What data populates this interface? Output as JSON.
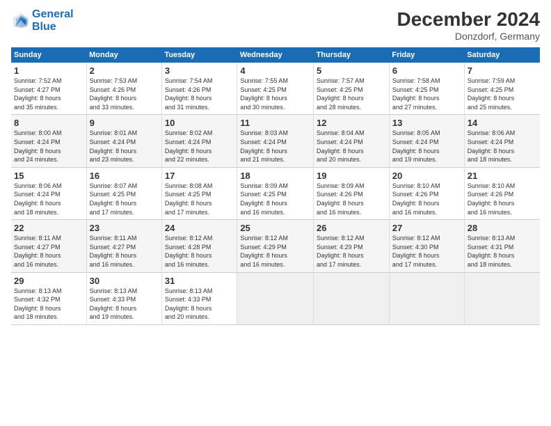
{
  "header": {
    "logo_line1": "General",
    "logo_line2": "Blue",
    "month_title": "December 2024",
    "location": "Donzdorf, Germany"
  },
  "days_of_week": [
    "Sunday",
    "Monday",
    "Tuesday",
    "Wednesday",
    "Thursday",
    "Friday",
    "Saturday"
  ],
  "weeks": [
    [
      {
        "day": "1",
        "sunrise": "7:52 AM",
        "sunset": "4:27 PM",
        "daylight": "8 hours and 35 minutes."
      },
      {
        "day": "2",
        "sunrise": "7:53 AM",
        "sunset": "4:26 PM",
        "daylight": "8 hours and 33 minutes."
      },
      {
        "day": "3",
        "sunrise": "7:54 AM",
        "sunset": "4:26 PM",
        "daylight": "8 hours and 31 minutes."
      },
      {
        "day": "4",
        "sunrise": "7:55 AM",
        "sunset": "4:25 PM",
        "daylight": "8 hours and 30 minutes."
      },
      {
        "day": "5",
        "sunrise": "7:57 AM",
        "sunset": "4:25 PM",
        "daylight": "8 hours and 28 minutes."
      },
      {
        "day": "6",
        "sunrise": "7:58 AM",
        "sunset": "4:25 PM",
        "daylight": "8 hours and 27 minutes."
      },
      {
        "day": "7",
        "sunrise": "7:59 AM",
        "sunset": "4:25 PM",
        "daylight": "8 hours and 25 minutes."
      }
    ],
    [
      {
        "day": "8",
        "sunrise": "8:00 AM",
        "sunset": "4:24 PM",
        "daylight": "8 hours and 24 minutes."
      },
      {
        "day": "9",
        "sunrise": "8:01 AM",
        "sunset": "4:24 PM",
        "daylight": "8 hours and 23 minutes."
      },
      {
        "day": "10",
        "sunrise": "8:02 AM",
        "sunset": "4:24 PM",
        "daylight": "8 hours and 22 minutes."
      },
      {
        "day": "11",
        "sunrise": "8:03 AM",
        "sunset": "4:24 PM",
        "daylight": "8 hours and 21 minutes."
      },
      {
        "day": "12",
        "sunrise": "8:04 AM",
        "sunset": "4:24 PM",
        "daylight": "8 hours and 20 minutes."
      },
      {
        "day": "13",
        "sunrise": "8:05 AM",
        "sunset": "4:24 PM",
        "daylight": "8 hours and 19 minutes."
      },
      {
        "day": "14",
        "sunrise": "8:06 AM",
        "sunset": "4:24 PM",
        "daylight": "8 hours and 18 minutes."
      }
    ],
    [
      {
        "day": "15",
        "sunrise": "8:06 AM",
        "sunset": "4:24 PM",
        "daylight": "8 hours and 18 minutes."
      },
      {
        "day": "16",
        "sunrise": "8:07 AM",
        "sunset": "4:25 PM",
        "daylight": "8 hours and 17 minutes."
      },
      {
        "day": "17",
        "sunrise": "8:08 AM",
        "sunset": "4:25 PM",
        "daylight": "8 hours and 17 minutes."
      },
      {
        "day": "18",
        "sunrise": "8:09 AM",
        "sunset": "4:25 PM",
        "daylight": "8 hours and 16 minutes."
      },
      {
        "day": "19",
        "sunrise": "8:09 AM",
        "sunset": "4:26 PM",
        "daylight": "8 hours and 16 minutes."
      },
      {
        "day": "20",
        "sunrise": "8:10 AM",
        "sunset": "4:26 PM",
        "daylight": "8 hours and 16 minutes."
      },
      {
        "day": "21",
        "sunrise": "8:10 AM",
        "sunset": "4:26 PM",
        "daylight": "8 hours and 16 minutes."
      }
    ],
    [
      {
        "day": "22",
        "sunrise": "8:11 AM",
        "sunset": "4:27 PM",
        "daylight": "8 hours and 16 minutes."
      },
      {
        "day": "23",
        "sunrise": "8:11 AM",
        "sunset": "4:27 PM",
        "daylight": "8 hours and 16 minutes."
      },
      {
        "day": "24",
        "sunrise": "8:12 AM",
        "sunset": "4:28 PM",
        "daylight": "8 hours and 16 minutes."
      },
      {
        "day": "25",
        "sunrise": "8:12 AM",
        "sunset": "4:29 PM",
        "daylight": "8 hours and 16 minutes."
      },
      {
        "day": "26",
        "sunrise": "8:12 AM",
        "sunset": "4:29 PM",
        "daylight": "8 hours and 17 minutes."
      },
      {
        "day": "27",
        "sunrise": "8:12 AM",
        "sunset": "4:30 PM",
        "daylight": "8 hours and 17 minutes."
      },
      {
        "day": "28",
        "sunrise": "8:13 AM",
        "sunset": "4:31 PM",
        "daylight": "8 hours and 18 minutes."
      }
    ],
    [
      {
        "day": "29",
        "sunrise": "8:13 AM",
        "sunset": "4:32 PM",
        "daylight": "8 hours and 18 minutes."
      },
      {
        "day": "30",
        "sunrise": "8:13 AM",
        "sunset": "4:33 PM",
        "daylight": "8 hours and 19 minutes."
      },
      {
        "day": "31",
        "sunrise": "8:13 AM",
        "sunset": "4:33 PM",
        "daylight": "8 hours and 20 minutes."
      },
      null,
      null,
      null,
      null
    ]
  ],
  "labels": {
    "sunrise": "Sunrise:",
    "sunset": "Sunset:",
    "daylight": "Daylight:"
  }
}
